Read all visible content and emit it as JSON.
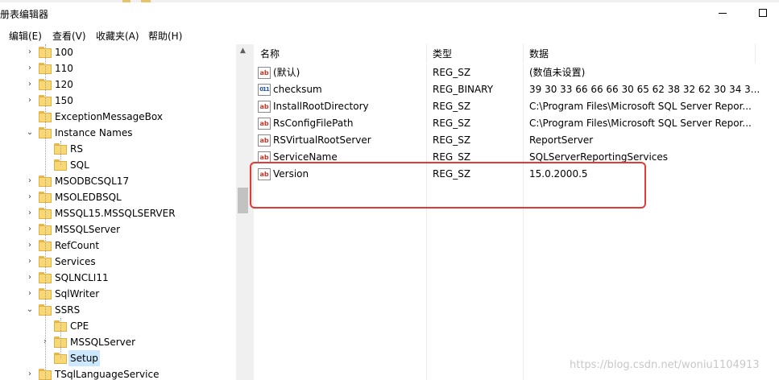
{
  "window": {
    "title": "册表编辑器"
  },
  "menu": [
    "编辑(E)",
    "查看(V)",
    "收藏夹(A)",
    "帮助(H)"
  ],
  "tree": {
    "items": [
      {
        "label": "100",
        "expander": "›",
        "level": 1
      },
      {
        "label": "110",
        "expander": "›",
        "level": 1
      },
      {
        "label": "120",
        "expander": "›",
        "level": 1
      },
      {
        "label": "150",
        "expander": "›",
        "level": 1
      },
      {
        "label": "ExceptionMessageBox",
        "expander": "",
        "level": 1
      },
      {
        "label": "Instance Names",
        "expander": "⌄",
        "level": 1
      },
      {
        "label": "RS",
        "expander": "",
        "level": 2
      },
      {
        "label": "SQL",
        "expander": "",
        "level": 2
      },
      {
        "label": "MSODBCSQL17",
        "expander": "›",
        "level": 1
      },
      {
        "label": "MSOLEDBSQL",
        "expander": "›",
        "level": 1
      },
      {
        "label": "MSSQL15.MSSQLSERVER",
        "expander": "›",
        "level": 1
      },
      {
        "label": "MSSQLServer",
        "expander": "›",
        "level": 1
      },
      {
        "label": "RefCount",
        "expander": "›",
        "level": 1
      },
      {
        "label": "Services",
        "expander": "›",
        "level": 1
      },
      {
        "label": "SQLNCLI11",
        "expander": "›",
        "level": 1
      },
      {
        "label": "SqlWriter",
        "expander": "›",
        "level": 1
      },
      {
        "label": "SSRS",
        "expander": "⌄",
        "level": 1
      },
      {
        "label": "CPE",
        "expander": "",
        "level": 2
      },
      {
        "label": "MSSQLServer",
        "expander": "›",
        "level": 2
      },
      {
        "label": "Setup",
        "expander": "",
        "level": 2,
        "selected": true
      },
      {
        "label": "TSqlLanguageService",
        "expander": "›",
        "level": 1
      }
    ]
  },
  "list": {
    "columns": [
      "名称",
      "类型",
      "数据"
    ],
    "rows": [
      {
        "icon": "string-value-icon",
        "name": "(默认)",
        "type": "REG_SZ",
        "data": "(数值未设置)"
      },
      {
        "icon": "binary-value-icon",
        "name": "checksum",
        "type": "REG_BINARY",
        "data": "39 30 33 66 66 66 30 65 62 38 32 62 30 34 3..."
      },
      {
        "icon": "string-value-icon",
        "name": "InstallRootDirectory",
        "type": "REG_SZ",
        "data": "C:\\Program Files\\Microsoft SQL Server Repor..."
      },
      {
        "icon": "string-value-icon",
        "name": "RsConfigFilePath",
        "type": "REG_SZ",
        "data": "C:\\Program Files\\Microsoft SQL Server Repor..."
      },
      {
        "icon": "string-value-icon",
        "name": "RSVirtualRootServer",
        "type": "REG_SZ",
        "data": "ReportServer"
      },
      {
        "icon": "string-value-icon",
        "name": "ServiceName",
        "type": "REG_SZ",
        "data": "SQLServerReportingServices"
      },
      {
        "icon": "string-value-icon",
        "name": "Version",
        "type": "REG_SZ",
        "data": "15.0.2000.5"
      }
    ]
  },
  "icons": {
    "string": "ab",
    "binary": "011"
  },
  "watermark": "https://blog.csdn.net/woniu1104913",
  "colors": {
    "highlight": "#e53935",
    "selection": "#cce8ff",
    "folder": "#f8d775"
  }
}
